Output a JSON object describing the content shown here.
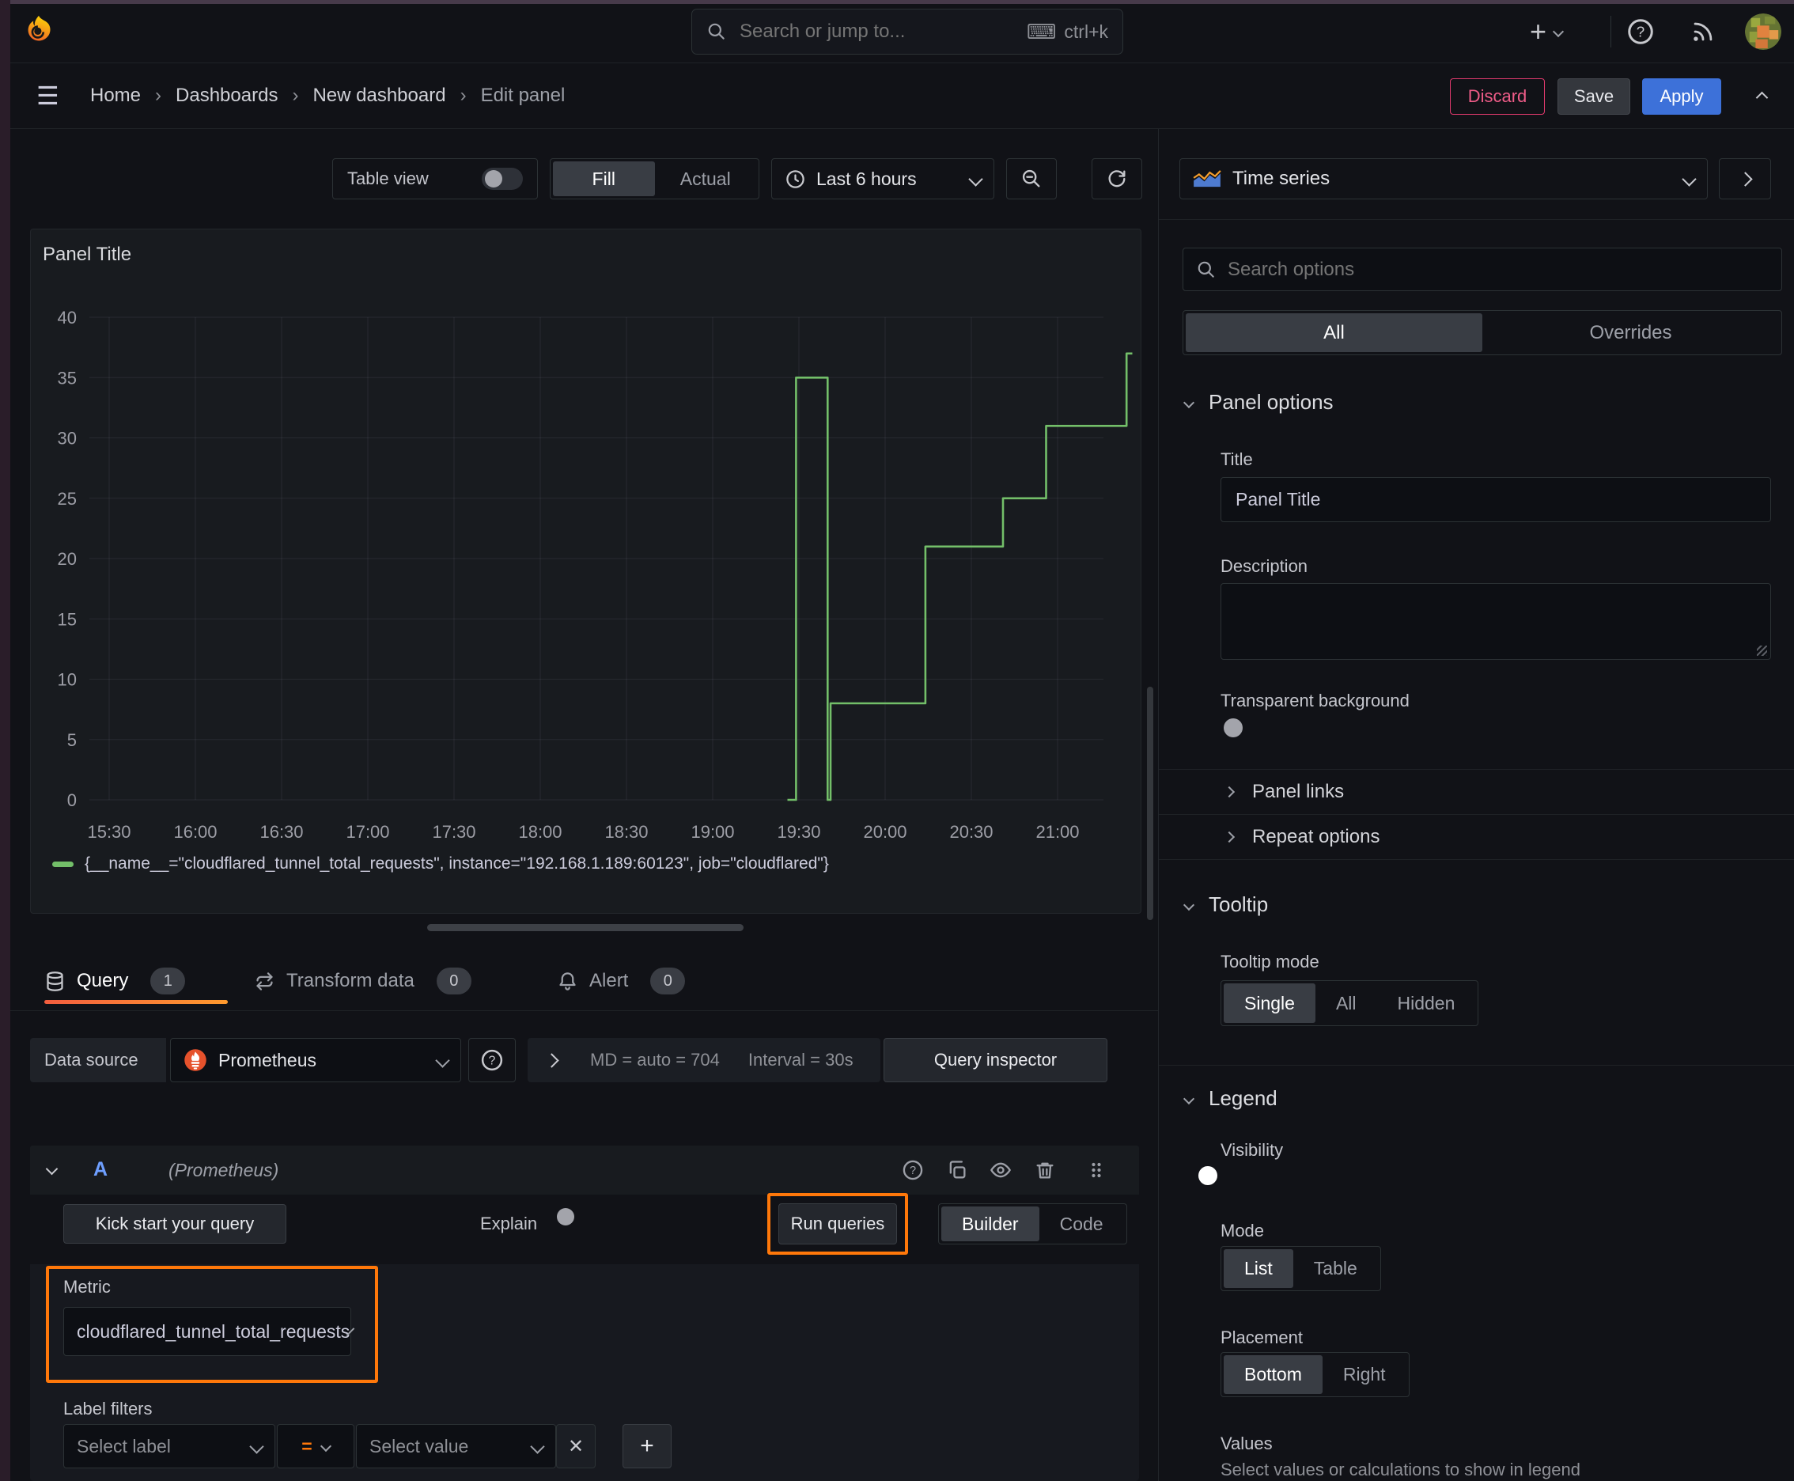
{
  "colors": {
    "accent_orange": "#ff780a",
    "series_green": "#73bf69",
    "primary_blue": "#3d71d9",
    "prometheus_orange": "#e6522c",
    "destructive_pink": "#e23a6e"
  },
  "icons": {
    "hamburger": "☰",
    "keyboard": "⌨",
    "plus": "+",
    "close": "✕",
    "sep": "›"
  },
  "topnav": {
    "search_placeholder": "Search or jump to...",
    "shortcut": "ctrl+k"
  },
  "breadcrumb": {
    "items": [
      "Home",
      "Dashboards",
      "New dashboard",
      "Edit panel"
    ]
  },
  "actions": {
    "discard": "Discard",
    "save": "Save",
    "apply": "Apply"
  },
  "toolbar": {
    "table_view": "Table view",
    "fill": "Fill",
    "actual": "Actual",
    "time_range": "Last 6 hours"
  },
  "viz_picker": {
    "label": "Time series"
  },
  "options_pane": {
    "search_placeholder": "Search options",
    "tabs": {
      "all": "All",
      "overrides": "Overrides"
    },
    "panel_options": {
      "heading": "Panel options",
      "title_label": "Title",
      "title_value": "Panel Title",
      "description_label": "Description",
      "transparent_label": "Transparent background",
      "panel_links": "Panel links",
      "repeat_options": "Repeat options"
    },
    "tooltip": {
      "heading": "Tooltip",
      "mode_label": "Tooltip mode",
      "modes": [
        "Single",
        "All",
        "Hidden"
      ],
      "active_mode": "Single"
    },
    "legend": {
      "heading": "Legend",
      "visibility_label": "Visibility",
      "mode_label": "Mode",
      "modes": [
        "List",
        "Table"
      ],
      "active_mode": "List",
      "placement_label": "Placement",
      "placements": [
        "Bottom",
        "Right"
      ],
      "active_placement": "Bottom",
      "values_label": "Values",
      "values_help": "Select values or calculations to show in legend"
    }
  },
  "query_tabs": [
    {
      "label": "Query",
      "count": "1"
    },
    {
      "label": "Transform data",
      "count": "0"
    },
    {
      "label": "Alert",
      "count": "0"
    }
  ],
  "datasource": {
    "label": "Data source",
    "name": "Prometheus",
    "md_stat": "MD = auto = 704",
    "interval_stat": "Interval = 30s",
    "inspector": "Query inspector"
  },
  "query_editor": {
    "ref_id": "A",
    "ds_hint": "(Prometheus)",
    "kick_start": "Kick start your query",
    "explain": "Explain",
    "run_queries": "Run queries",
    "builder": "Builder",
    "code": "Code",
    "metric_label": "Metric",
    "metric_value": "cloudflared_tunnel_total_requests",
    "label_filters_label": "Label filters",
    "select_label_placeholder": "Select label",
    "operator": "=",
    "select_value_placeholder": "Select value"
  },
  "chart_data": {
    "type": "line",
    "title": "Panel Title",
    "x_ticks": [
      "15:30",
      "16:00",
      "16:30",
      "17:00",
      "17:30",
      "18:00",
      "18:30",
      "19:00",
      "19:30",
      "20:00",
      "20:30",
      "21:00"
    ],
    "y_ticks": [
      0,
      5,
      10,
      15,
      20,
      25,
      30,
      35,
      40
    ],
    "ylim": [
      0,
      40
    ],
    "xlabel": "",
    "ylabel": "",
    "grid": true,
    "legend_position": "bottom",
    "time_range_label": "Last 6 hours",
    "series": [
      {
        "name": "{__name__=\"cloudflared_tunnel_total_requests\", instance=\"192.168.1.189:60123\", job=\"cloudflared\"}",
        "color": "#73bf69",
        "points": [
          [
            "19:26",
            0
          ],
          [
            "19:29",
            0
          ],
          [
            "19:29",
            35
          ],
          [
            "19:40",
            35
          ],
          [
            "19:40",
            0
          ],
          [
            "19:41",
            0
          ],
          [
            "19:41",
            8
          ],
          [
            "20:14",
            8
          ],
          [
            "20:14",
            21
          ],
          [
            "20:41",
            21
          ],
          [
            "20:41",
            25
          ],
          [
            "20:56",
            25
          ],
          [
            "20:56",
            31
          ],
          [
            "21:24",
            31
          ],
          [
            "21:24",
            37
          ],
          [
            "21:26",
            37
          ]
        ]
      }
    ]
  }
}
